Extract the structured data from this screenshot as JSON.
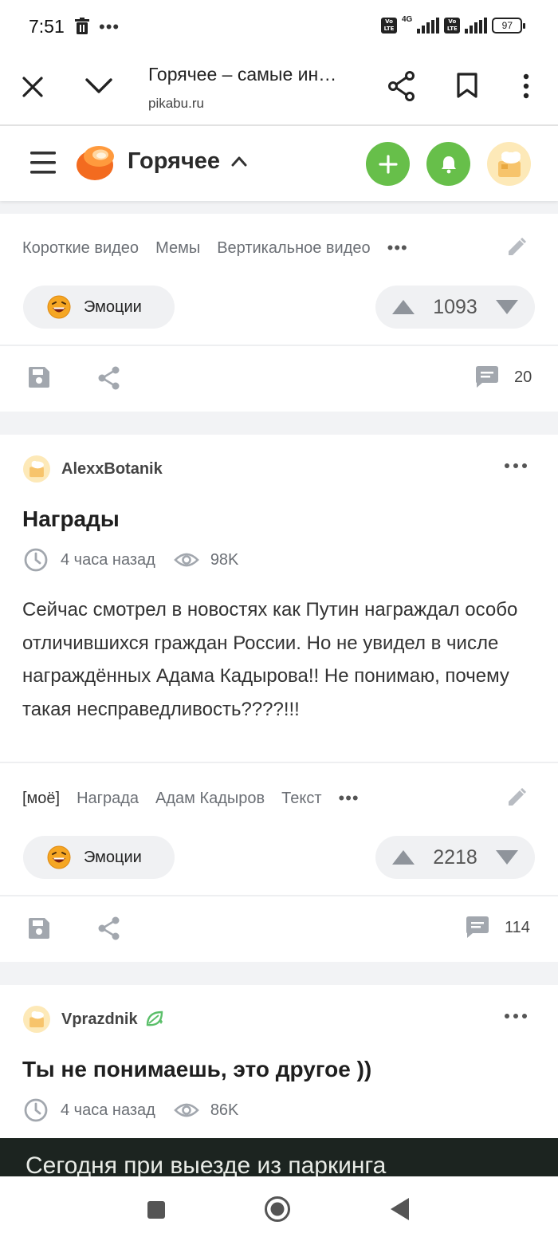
{
  "status": {
    "time": "7:51",
    "battery": "97",
    "network": "4G",
    "volte": "Vo LTE"
  },
  "browser": {
    "title": "Горячее – самые ин…",
    "url": "pikabu.ru"
  },
  "site": {
    "section_title": "Горячее"
  },
  "post1": {
    "tags": [
      "Короткие видео",
      "Мемы",
      "Вертикальное видео"
    ],
    "more_tags": "•••",
    "emotions_label": "Эмоции",
    "rating": "1093",
    "comments": "20"
  },
  "post2": {
    "author": "AlexxBotanik",
    "title": "Награды",
    "time": "4 часа назад",
    "views": "98K",
    "text": "Сейчас смотрел в новостях как Путин награждал особо отличившихся граждан России. Но не увидел в числе награждённых Адама Кадырова!! Не понимаю, почему такая несправедливость????!!!",
    "tags": [
      "[моё]",
      "Награда",
      "Адам Кадыров",
      "Текст"
    ],
    "more_tags": "•••",
    "emotions_label": "Эмоции",
    "rating": "2218",
    "comments": "114"
  },
  "post3": {
    "author": "Vprazdnik",
    "title": "Ты не понимаешь, это другое ))",
    "time": "4 часа назад",
    "views": "86K",
    "media_caption": "Сегодня при выезде из паркинга"
  },
  "colors": {
    "green": "#67bf4a",
    "accent_orange": "#ff6a1a"
  }
}
